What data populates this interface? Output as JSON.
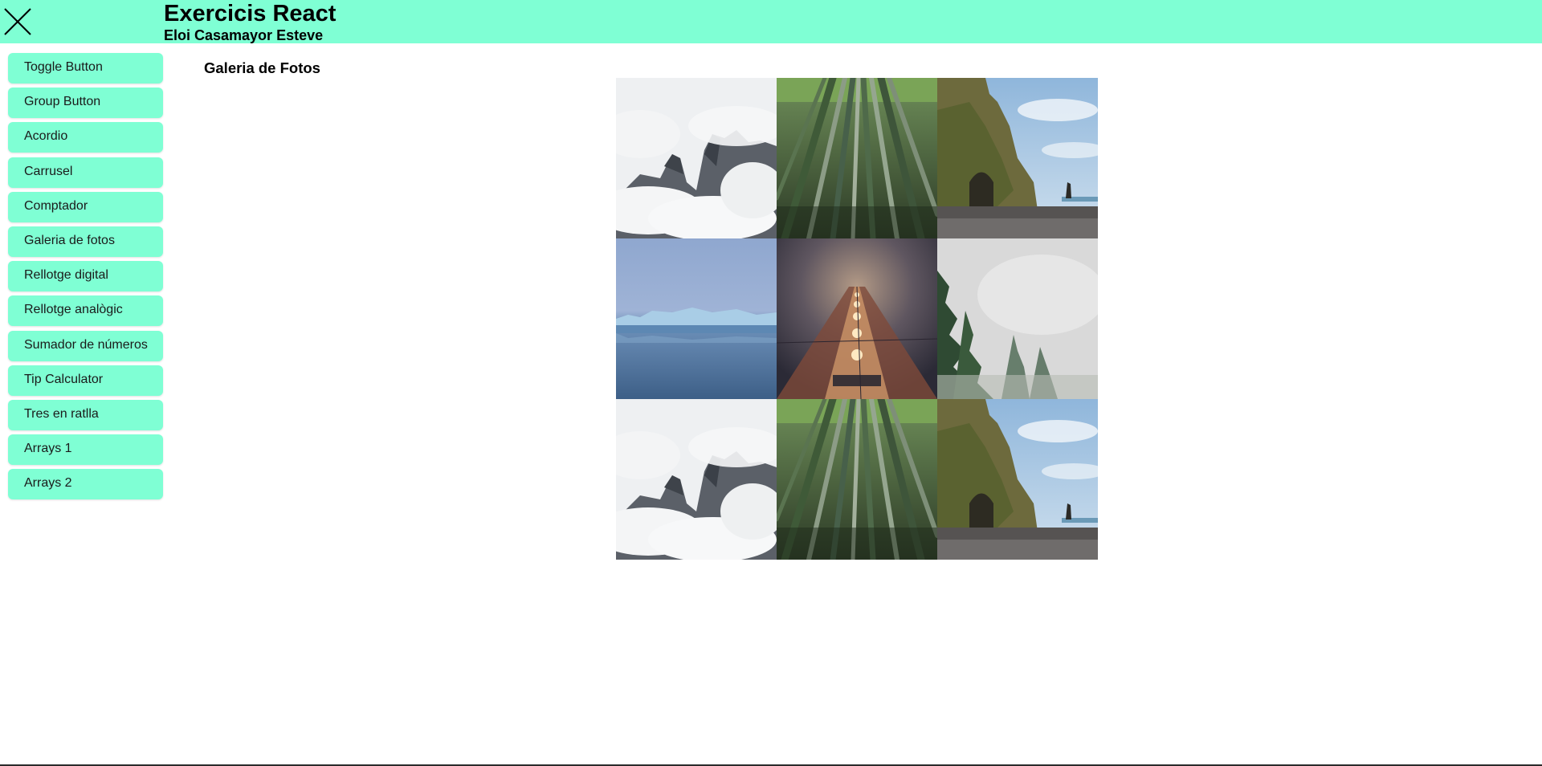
{
  "colors": {
    "accent": "#7fffd4"
  },
  "header": {
    "close_icon": "close-icon",
    "title": "Exercicis React",
    "subtitle": "Eloi Casamayor Esteve"
  },
  "sidebar": {
    "items": [
      {
        "label": "Toggle Button"
      },
      {
        "label": "Group Button"
      },
      {
        "label": "Acordio"
      },
      {
        "label": "Carrusel"
      },
      {
        "label": "Comptador"
      },
      {
        "label": "Galeria de fotos"
      },
      {
        "label": "Rellotge digital"
      },
      {
        "label": "Rellotge analògic"
      },
      {
        "label": "Sumador de números"
      },
      {
        "label": "Tip Calculator"
      },
      {
        "label": "Tres en ratlla"
      },
      {
        "label": "Arrays 1"
      },
      {
        "label": "Arrays 2"
      }
    ]
  },
  "main": {
    "section_title": "Galeria de Fotos",
    "photos": [
      {
        "subject": "misty-mountains"
      },
      {
        "subject": "bamboo-forest"
      },
      {
        "subject": "sea-cliff"
      },
      {
        "subject": "glacier-lake"
      },
      {
        "subject": "foggy-railway-night"
      },
      {
        "subject": "misty-pine-forest"
      },
      {
        "subject": "misty-mountains"
      },
      {
        "subject": "bamboo-forest"
      },
      {
        "subject": "sea-cliff"
      }
    ]
  }
}
